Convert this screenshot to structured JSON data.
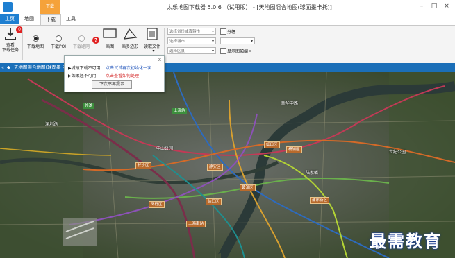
{
  "window": {
    "title": "太乐地图下载器 5.0.6 （试用版） - [天地图混合地图(球面墨卡托)]",
    "title_tab": "下载",
    "colors": {
      "accent": "#1e7fd1",
      "tab_orange": "#f5a23a",
      "infobar": "#1b6fb8"
    }
  },
  "menu": {
    "home": "主页",
    "tabs": [
      "地图",
      "下载",
      "工具"
    ]
  },
  "ribbon": {
    "view_tasks": "查看\n下载任务",
    "tasks_badge": "0",
    "radio_labels": [
      "下载地图",
      "下载POI",
      "下载路网"
    ],
    "tools": [
      "画图",
      "画多边形",
      "读取文件"
    ],
    "combos": [
      "选择省份或直辖市",
      "选择城市",
      "选择区县"
    ],
    "checkboxes": [
      "分幅",
      "显示图幅编号"
    ]
  },
  "infobar": {
    "text": "天地图混合地图(球面墨卡托)"
  },
  "popup": {
    "line1_prefix": "▶城镇下载不可用",
    "line1_link": "点击试试再次初始化一次",
    "line2_prefix": "▶如果还不可用",
    "line2_link": "点击查看如何处理",
    "button": "下次不再提示",
    "close": "x"
  },
  "map": {
    "labels": [
      "深圳路",
      "新华中路",
      "中山公园",
      "长宁区",
      "静安区",
      "黄浦区",
      "虹口区",
      "杨浦区",
      "徐汇区",
      "浦东新区",
      "闵行区",
      "上海南站",
      "上海站",
      "外滩",
      "陆家嘴",
      "世纪公园"
    ]
  },
  "watermark": "最需教育"
}
